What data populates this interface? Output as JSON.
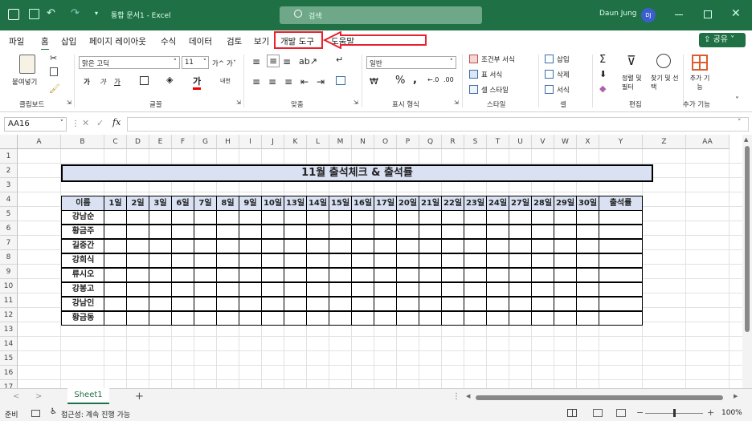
{
  "window": {
    "doc_title": "통합 문서1 - Excel",
    "search_placeholder": "검색",
    "user": "Daun Jung",
    "user_initials": "DJ"
  },
  "menu": {
    "tabs": [
      "파일",
      "홈",
      "삽입",
      "페이지 레이아웃",
      "수식",
      "데이터",
      "검토",
      "보기",
      "개발 도구",
      "도움말"
    ],
    "share": "공유",
    "highlighted": "개발 도구"
  },
  "ribbon": {
    "clipboard": {
      "paste": "붙여넣기",
      "label": "클립보드"
    },
    "font": {
      "name": "맑은 고딕",
      "size": "11",
      "label": "글꼴",
      "bold": "가",
      "italic": "가",
      "underline": "가",
      "grow": "가^",
      "shrink": "가ˇ"
    },
    "align": {
      "label": "맞춤"
    },
    "number": {
      "format": "일반",
      "label": "표시 형식"
    },
    "styles": {
      "cond": "조건부 서식",
      "table": "표 서식",
      "cell": "셀 스타일",
      "label": "스타일"
    },
    "cells": {
      "insert": "삽입",
      "delete": "삭제",
      "format": "서식",
      "label": "셀"
    },
    "editing": {
      "sort": "정렬 및 필터",
      "find": "찾기 및 선택",
      "label": "편집"
    },
    "addins": {
      "btn": "추가 기능",
      "label": "추가 기능"
    }
  },
  "formula": {
    "namebox": "AA16",
    "fx": "fx"
  },
  "columns": [
    "A",
    "B",
    "C",
    "D",
    "E",
    "F",
    "G",
    "H",
    "I",
    "J",
    "K",
    "L",
    "M",
    "N",
    "O",
    "P",
    "Q",
    "R",
    "S",
    "T",
    "U",
    "V",
    "W",
    "X",
    "Y",
    "Z",
    "AA"
  ],
  "rows": [
    "1",
    "2",
    "3",
    "4",
    "5",
    "6",
    "7",
    "8",
    "9",
    "10",
    "11",
    "12",
    "13",
    "14",
    "15",
    "16",
    "17"
  ],
  "sheet": {
    "title": "11월 출석체크 & 출석률",
    "header_name": "이름",
    "dates": [
      "1일",
      "2일",
      "3일",
      "6일",
      "7일",
      "8일",
      "9일",
      "10일",
      "13일",
      "14일",
      "15일",
      "16일",
      "17일",
      "20일",
      "21일",
      "22일",
      "23일",
      "24일",
      "27일",
      "28일",
      "29일",
      "30일"
    ],
    "header_rate": "출석률",
    "names": [
      "강남순",
      "황금주",
      "길중간",
      "강희식",
      "류시오",
      "강봉고",
      "강남인",
      "황금동"
    ]
  },
  "sheet_tabs": {
    "active": "Sheet1",
    "add": "+"
  },
  "status": {
    "ready": "준비",
    "accessibility": "접근성: 계속 진행 가능",
    "zoom": "100%"
  },
  "colors": {
    "excel_green": "#1f7145",
    "header_fill": "#d9e1f2",
    "highlight_red": "#e8212e"
  }
}
